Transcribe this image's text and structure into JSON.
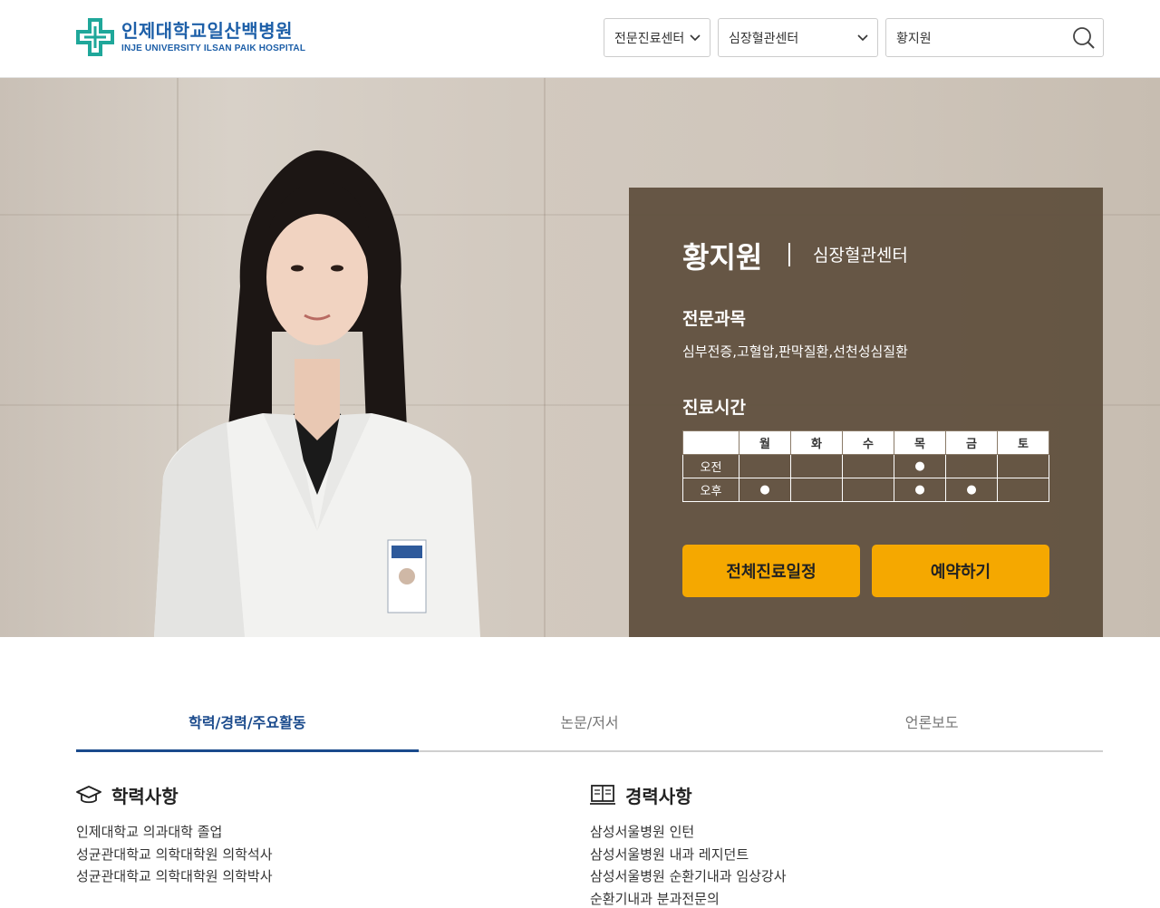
{
  "header": {
    "logo_korean": "인제대학교일산백병원",
    "logo_english": "INJE UNIVERSITY ILSAN PAIK HOSPITAL",
    "select_center_type": "전문진료센터",
    "select_center": "심장혈관센터",
    "search_value": "황지원",
    "brand_color": "#1d5fa8",
    "accent_color": "#1fa79a"
  },
  "doctor": {
    "name": "황지원",
    "department": "심장혈관센터",
    "specialty_heading": "전문과목",
    "specialty": "심부전증,고혈압,판막질환,선천성심질환",
    "schedule_heading": "진료시간",
    "schedule": {
      "days": [
        "월",
        "화",
        "수",
        "목",
        "금",
        "토"
      ],
      "rows": [
        {
          "label": "오전",
          "cells": [
            "",
            "",
            "",
            "●",
            "",
            ""
          ]
        },
        {
          "label": "오후",
          "cells": [
            "●",
            "",
            "",
            "●",
            "●",
            ""
          ]
        }
      ]
    },
    "button_full_schedule": "전체진료일정",
    "button_reserve": "예약하기",
    "button_color": "#f5a800"
  },
  "tabs": [
    {
      "label": "학력/경력/주요활동",
      "active": true
    },
    {
      "label": "논문/저서",
      "active": false
    },
    {
      "label": "언론보도",
      "active": false
    }
  ],
  "education": {
    "title": "학력사항",
    "icon": "graduation-cap-icon",
    "items": [
      "인제대학교 의과대학 졸업",
      "성균관대학교 의학대학원 의학석사",
      "성균관대학교 의학대학원 의학박사"
    ]
  },
  "career": {
    "title": "경력사항",
    "icon": "open-book-icon",
    "items": [
      "삼성서울병원 인턴",
      "삼성서울병원 내과 레지던트",
      "삼성서울병원 순환기내과 임상강사",
      "순환기내과 분과전문의"
    ]
  }
}
